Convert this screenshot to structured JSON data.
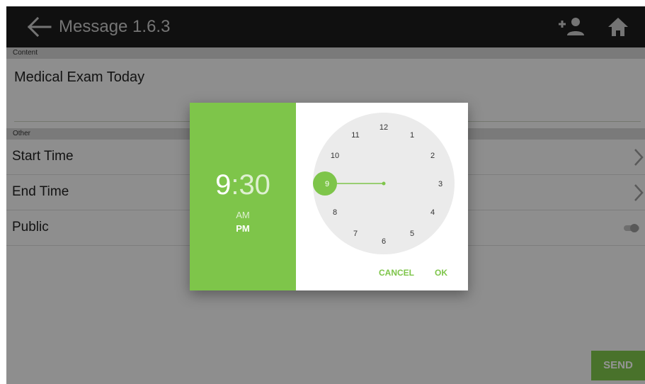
{
  "header": {
    "title": "Message 1.6.3"
  },
  "content_section": {
    "label": "Content",
    "value": "Medical Exam Today"
  },
  "other_section": {
    "label": "Other",
    "rows": [
      {
        "label": "Start Time"
      },
      {
        "label": "End Time"
      },
      {
        "label": "Public"
      }
    ]
  },
  "send_label": "SEND",
  "time_picker": {
    "hour": "9",
    "separator": ":",
    "minute": "30",
    "am_label": "AM",
    "pm_label": "PM",
    "selected_period": "PM",
    "cancel_label": "CANCEL",
    "ok_label": "OK",
    "accent_color": "#7ec54a"
  },
  "icons": {
    "back": "arrow-left-icon",
    "add_user": "add-user-icon",
    "home": "home-icon",
    "chevron": "chevron-right-icon"
  }
}
